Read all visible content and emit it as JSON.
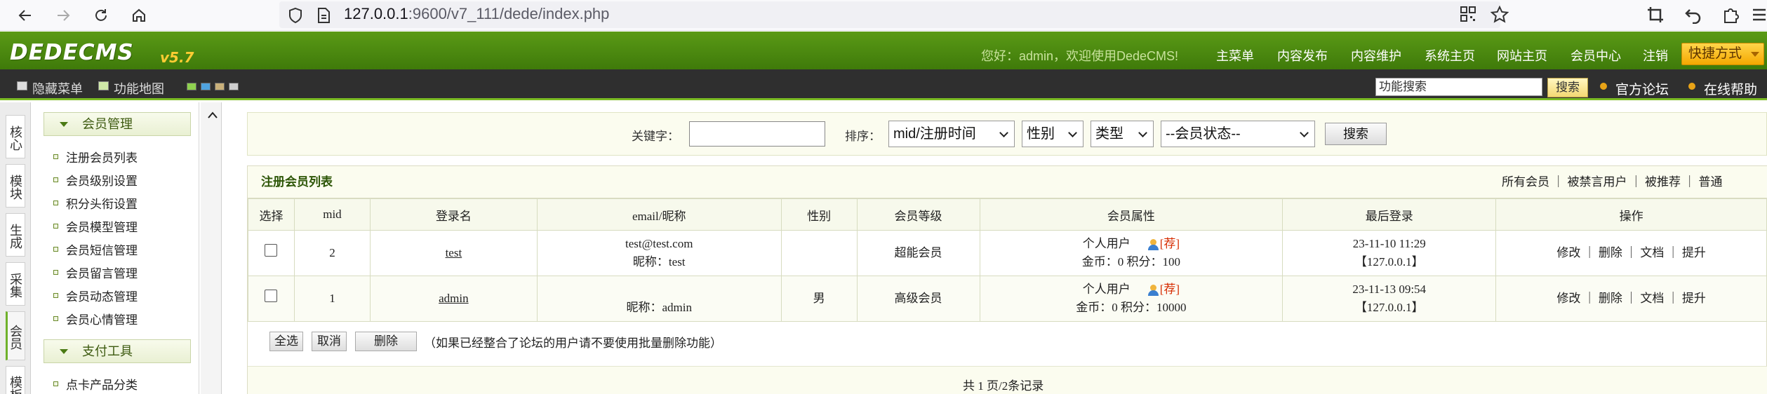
{
  "browser": {
    "url_host": "127.0.0.1",
    "url_rest": ":9600/v7_111/dede/index.php"
  },
  "header": {
    "logo": "DEDECMS",
    "version": "v5.7",
    "welcome": "您好：admin，欢迎使用DedeCMS!",
    "nav": [
      "主菜单",
      "内容发布",
      "内容维护",
      "系统主页",
      "网站主页",
      "会员中心",
      "注销"
    ],
    "quick_menu": "快捷方式"
  },
  "toolbar": {
    "hide_menu": "隐藏菜单",
    "func_map": "功能地图",
    "search_value": "功能搜索",
    "search_btn": "搜索",
    "forum": "官方论坛",
    "help": "在线帮助"
  },
  "vtabs": [
    "核心",
    "模块",
    "生成",
    "采集",
    "会员",
    "模板"
  ],
  "sidebar": {
    "group1": "会员管理",
    "items": [
      "注册会员列表",
      "会员级别设置",
      "积分头衔设置",
      "会员模型管理",
      "会员短信管理",
      "会员留言管理",
      "会员动态管理",
      "会员心情管理"
    ],
    "group2": "支付工具",
    "items2": [
      "点卡产品分类"
    ]
  },
  "search": {
    "keyword_label": "关键字：",
    "sort_label": "排序：",
    "sort_value": "mid/注册时间",
    "gender_value": "性别",
    "type_value": "类型",
    "status_value": "--会员状态--",
    "button": "搜索"
  },
  "list": {
    "title": "注册会员列表",
    "filters": "所有会员 ｜ 被禁言用户 ｜ 被推荐 ｜ 普通",
    "columns": [
      "选择",
      "mid",
      "登录名",
      "email/昵称",
      "性别",
      "会员等级",
      "会员属性",
      "最后登录",
      "操作"
    ],
    "rows": [
      {
        "mid": "2",
        "login": "test",
        "email": "test@test.com",
        "nick": "昵称：test",
        "gender": "",
        "level": "超能会员",
        "attr_type": "个人用户",
        "attr_rec": "[荐]",
        "attr_points": "金币：0 积分：100",
        "last_time": "23-11-10 11:29",
        "last_ip": "【127.0.0.1】",
        "ops": "修改 ｜ 删除 ｜ 文档 ｜ 提升"
      },
      {
        "mid": "1",
        "login": "admin",
        "email": "",
        "nick": "昵称：admin",
        "gender": "男",
        "level": "高级会员",
        "attr_type": "个人用户",
        "attr_rec": "[荐]",
        "attr_points": "金币：0 积分：10000",
        "last_time": "23-11-13 09:54",
        "last_ip": "【127.0.0.1】",
        "ops": "修改 ｜ 删除 ｜ 文档 ｜ 提升"
      }
    ],
    "select_all": "全选",
    "cancel": "取消",
    "delete": "删除",
    "note": "（如果已经整合了论坛的用户请不要使用批量删除功能）",
    "pager": "共 1 页/2条记录"
  }
}
